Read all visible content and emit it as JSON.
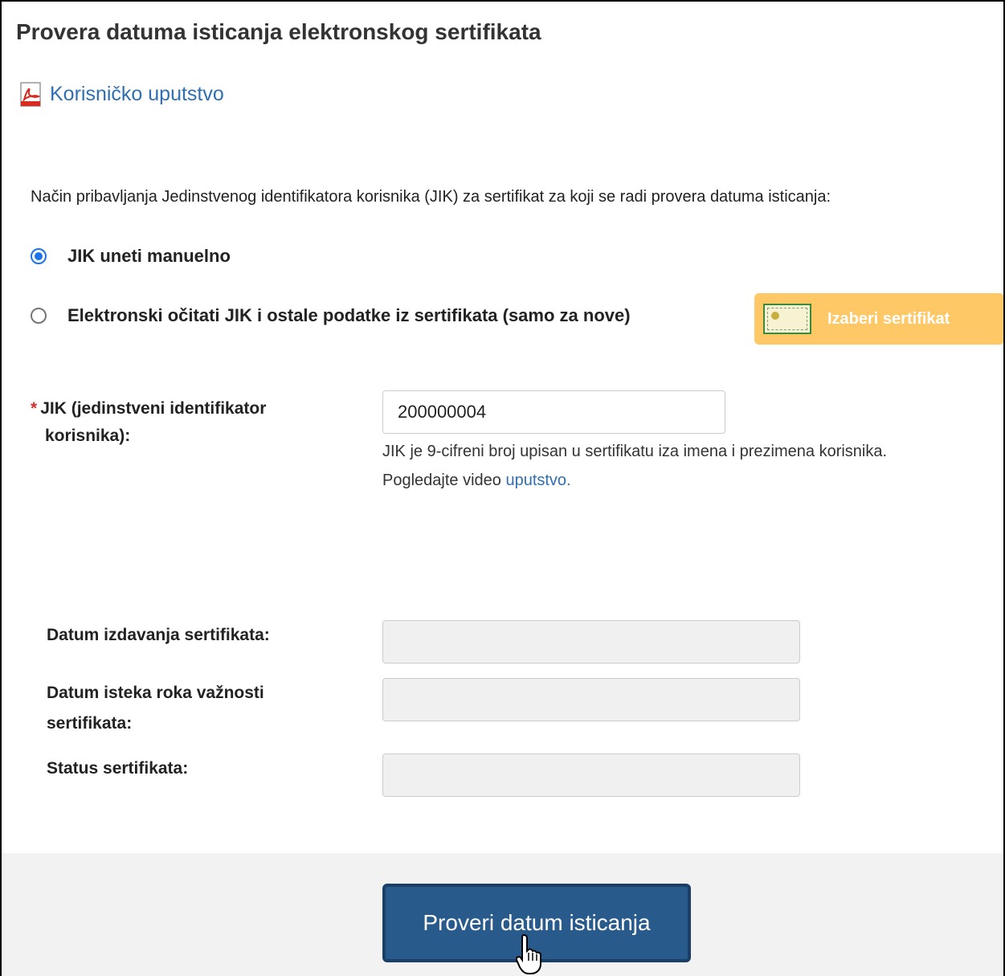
{
  "page": {
    "title": "Provera datuma isticanja elektronskog sertifikata",
    "manual_link": "Korisničko uputstvo"
  },
  "method": {
    "prompt": "Način pribavljanja Jedinstvenog identifikatora korisnika (JIK) za sertifikat za koji se radi provera datuma isticanja:",
    "options": [
      {
        "label": "JIK uneti manuelno",
        "selected": true
      },
      {
        "label": "Elektronski očitati JIK i ostale podatke iz sertifikata (samo za nove)",
        "selected": false
      }
    ],
    "cert_button_label": "Izaberi sertifikat"
  },
  "jik": {
    "required_marker": "*",
    "label_line1": "JIK (jedinstveni identifikator",
    "label_line2": "korisnika):",
    "value": "200000004",
    "help_line1": "JIK je 9-cifreni broj upisan u sertifikatu iza imena i prezimena korisnika.",
    "help_line2_prefix": "Pogledajte video",
    "help_link": "uputstvo."
  },
  "results": {
    "issue_date_label": "Datum izdavanja sertifikata:",
    "expiry_label_line1": "Datum isteka roka važnosti",
    "expiry_label_line2": "sertifikata:",
    "status_label": "Status sertifikata:",
    "issue_date_value": "",
    "expiry_value": "",
    "status_value": ""
  },
  "footer": {
    "submit_label": "Proveri datum isticanja"
  },
  "colors": {
    "link": "#2f6fb2",
    "cert_button": "#ffc866",
    "submit_button": "#285a8c",
    "radio_selected": "#1a73e8",
    "required": "#d9302c"
  },
  "icons": {
    "manual": "pdf-icon",
    "cert_button": "certificate-icon",
    "pointer": "hand-cursor-icon"
  }
}
